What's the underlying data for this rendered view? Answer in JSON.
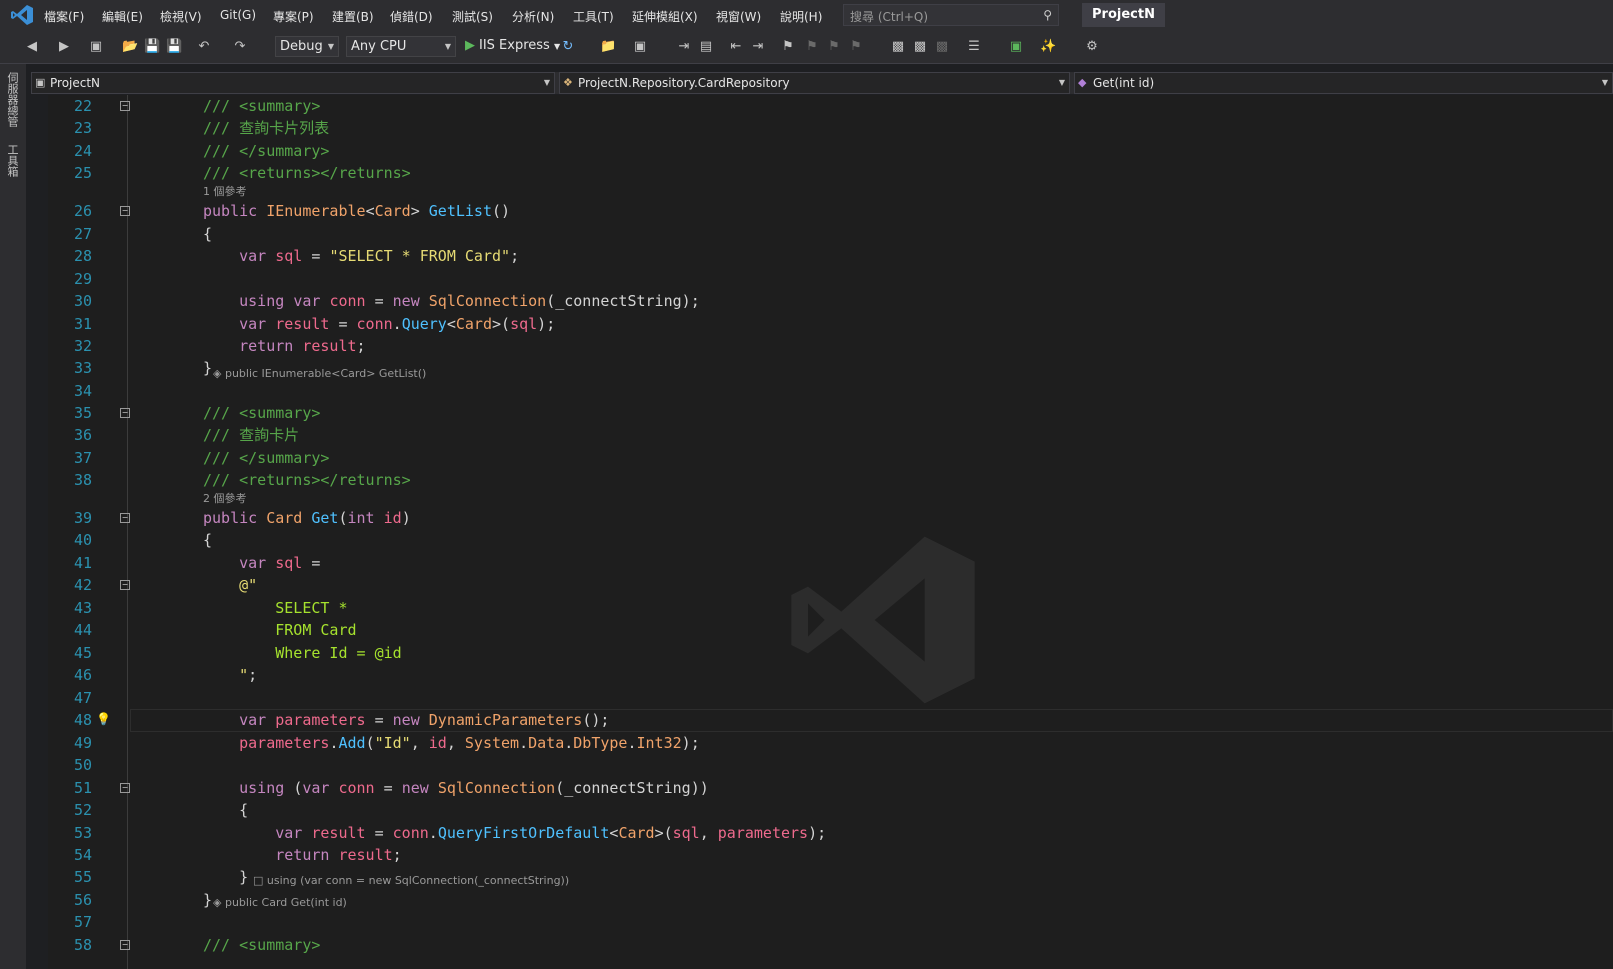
{
  "menu": {
    "items": [
      "檔案(F)",
      "編輯(E)",
      "檢視(V)",
      "Git(G)",
      "專案(P)",
      "建置(B)",
      "偵錯(D)",
      "測試(S)",
      "分析(N)",
      "工具(T)",
      "延伸模組(X)",
      "視窗(W)",
      "說明(H)"
    ],
    "search_placeholder": "搜尋 (Ctrl+Q)",
    "project_title": "ProjectN"
  },
  "toolbar": {
    "config": "Debug",
    "platform": "Any CPU",
    "run_target": "IIS Express"
  },
  "left_strip": {
    "tabs": [
      "伺服器總管",
      "工具箱"
    ]
  },
  "navbar": {
    "project": "ProjectN",
    "class": "ProjectN.Repository.CardRepository",
    "member": "Get(int id)"
  },
  "editor": {
    "lines": [
      {
        "n": "22",
        "text": "/// <summary>"
      },
      {
        "n": "23",
        "text": "/// 查詢卡片列表"
      },
      {
        "n": "24",
        "text": "/// </summary>"
      },
      {
        "n": "25",
        "text": "/// <returns></returns>"
      },
      {
        "n": "26",
        "text": "public IEnumerable<Card> GetList()"
      },
      {
        "n": "27",
        "text": "{"
      },
      {
        "n": "28",
        "text": "    var sql = \"SELECT * FROM Card\";"
      },
      {
        "n": "29",
        "text": ""
      },
      {
        "n": "30",
        "text": "    using var conn = new SqlConnection(_connectString);"
      },
      {
        "n": "31",
        "text": "    var result = conn.Query<Card>(sql);"
      },
      {
        "n": "32",
        "text": "    return result;"
      },
      {
        "n": "33",
        "text": "}"
      },
      {
        "n": "34",
        "text": ""
      },
      {
        "n": "35",
        "text": "/// <summary>"
      },
      {
        "n": "36",
        "text": "/// 查詢卡片"
      },
      {
        "n": "37",
        "text": "/// </summary>"
      },
      {
        "n": "38",
        "text": "/// <returns></returns>"
      },
      {
        "n": "39",
        "text": "public Card Get(int id)"
      },
      {
        "n": "40",
        "text": "{"
      },
      {
        "n": "41",
        "text": "    var sql ="
      },
      {
        "n": "42",
        "text": "    @\""
      },
      {
        "n": "43",
        "text": "        SELECT *"
      },
      {
        "n": "44",
        "text": "        FROM Card"
      },
      {
        "n": "45",
        "text": "        Where Id = @id"
      },
      {
        "n": "46",
        "text": "    \";"
      },
      {
        "n": "47",
        "text": ""
      },
      {
        "n": "48",
        "text": "    var parameters = new DynamicParameters();"
      },
      {
        "n": "49",
        "text": "    parameters.Add(\"Id\", id, System.Data.DbType.Int32);"
      },
      {
        "n": "50",
        "text": ""
      },
      {
        "n": "51",
        "text": "    using (var conn = new SqlConnection(_connectString))"
      },
      {
        "n": "52",
        "text": "    {"
      },
      {
        "n": "53",
        "text": "        var result = conn.QueryFirstOrDefault<Card>(sql, parameters);"
      },
      {
        "n": "54",
        "text": "        return result;"
      },
      {
        "n": "55",
        "text": "    }"
      },
      {
        "n": "56",
        "text": "}"
      },
      {
        "n": "57",
        "text": ""
      },
      {
        "n": "58",
        "text": "/// <summary>"
      }
    ],
    "codelens_getlist": "1 個參考",
    "codelens_get": "2 個參考",
    "hint_getlist_end": "public IEnumerable<Card> GetList()",
    "hint_using_end": "using (var conn = new SqlConnection(_connectString))",
    "hint_get_end": "public Card Get(int id)"
  }
}
